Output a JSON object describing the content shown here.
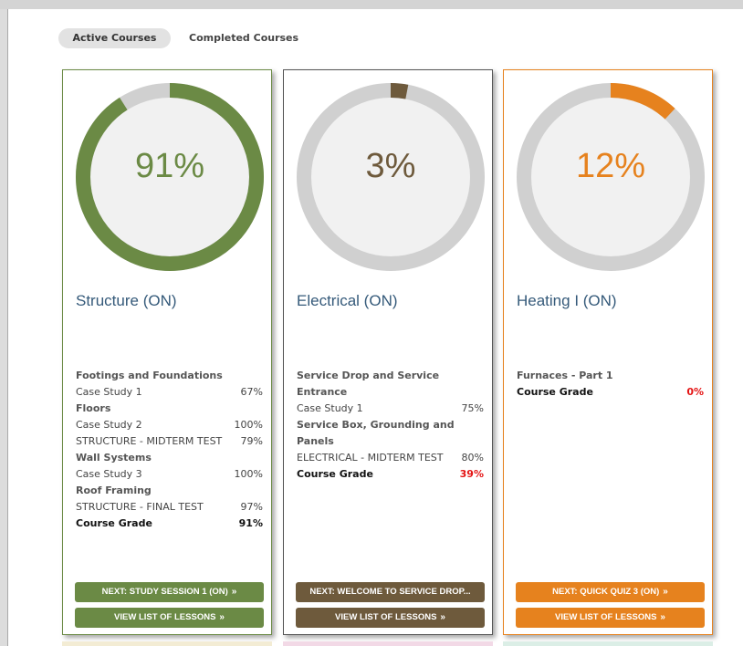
{
  "tabs": {
    "active": "Active Courses",
    "completed": "Completed Courses"
  },
  "chevron": "»",
  "courses": [
    {
      "title": "Structure (ON)",
      "percent_label": "91%",
      "progress": 0.91,
      "color": "#6b8a45",
      "lessons": [
        {
          "type": "heading",
          "text": "Footings and Foundations"
        },
        {
          "type": "item",
          "name": "Case Study 1",
          "value": "67%"
        },
        {
          "type": "heading",
          "text": "Floors"
        },
        {
          "type": "item",
          "name": "Case Study 2",
          "value": "100%"
        },
        {
          "type": "item",
          "name": "STRUCTURE - MIDTERM TEST",
          "value": "79%"
        },
        {
          "type": "heading",
          "text": "Wall Systems"
        },
        {
          "type": "item",
          "name": "Case Study 3",
          "value": "100%"
        },
        {
          "type": "heading",
          "text": "Roof Framing"
        },
        {
          "type": "item",
          "name": "STRUCTURE - FINAL TEST",
          "value": "97%"
        }
      ],
      "grade_label": "Course Grade",
      "grade_value": "91%",
      "next_button": "NEXT: STUDY SESSION 1 (ON)",
      "list_button": "VIEW LIST OF LESSONS"
    },
    {
      "title": "Electrical (ON)",
      "percent_label": "3%",
      "progress": 0.03,
      "color": "#6e5a3c",
      "lessons": [
        {
          "type": "heading",
          "text": "Service Drop and Service"
        },
        {
          "type": "heading",
          "text": "Entrance"
        },
        {
          "type": "item",
          "name": "Case Study 1",
          "value": "75%"
        },
        {
          "type": "heading",
          "text": "Service Box, Grounding and"
        },
        {
          "type": "heading",
          "text": "Panels"
        },
        {
          "type": "item",
          "name": "ELECTRICAL - MIDTERM TEST",
          "value": "80%"
        }
      ],
      "grade_label": "Course Grade",
      "grade_value": "39%",
      "next_button": "NEXT: WELCOME TO SERVICE DROP...",
      "list_button": "VIEW LIST OF LESSONS"
    },
    {
      "title": "Heating I (ON)",
      "percent_label": "12%",
      "progress": 0.12,
      "color": "#e6821e",
      "lessons": [
        {
          "type": "heading",
          "text": "Furnaces - Part 1"
        }
      ],
      "grade_label": "Course Grade",
      "grade_value": "0%",
      "next_button": "NEXT: QUICK QUIZ 3 (ON)",
      "list_button": "VIEW LIST OF LESSONS"
    }
  ]
}
